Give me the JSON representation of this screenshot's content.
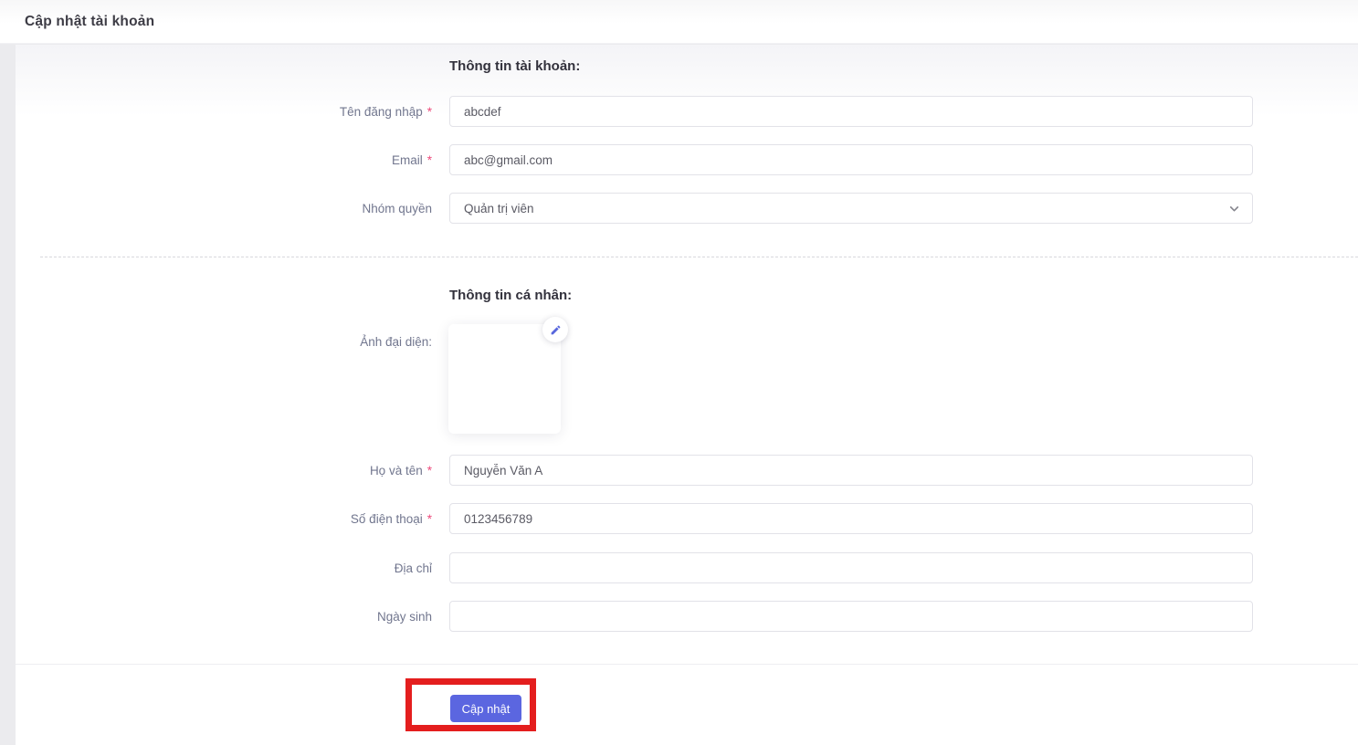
{
  "header": {
    "title": "Cập nhật tài khoản"
  },
  "account_section": {
    "title": "Thông tin tài khoản:",
    "fields": [
      {
        "label": "Tên đăng nhập",
        "required": "*",
        "value": "abcdef"
      },
      {
        "label": "Email",
        "required": "*",
        "value": "abc@gmail.com"
      },
      {
        "label": "Nhóm quyền",
        "required": "",
        "value": "Quản trị viên"
      }
    ]
  },
  "personal_section": {
    "title": "Thông tin cá nhân:",
    "avatar": {
      "label": "Ảnh đại diện:",
      "edit_icon": "pencil-icon"
    },
    "fields": [
      {
        "label": "Họ và tên",
        "required": "*",
        "value": "Nguyễn Văn A"
      },
      {
        "label": "Số điện thoại",
        "required": "*",
        "value": "0123456789"
      },
      {
        "label": "Địa chỉ",
        "required": "",
        "value": ""
      },
      {
        "label": "Ngày sinh",
        "required": "",
        "value": ""
      }
    ]
  },
  "footer": {
    "submit_label": "Cập nhật"
  },
  "icons": {
    "select_chevron": "chevron-down-icon",
    "avatar_edit": "pencil-icon"
  },
  "colors": {
    "primary_button": "#5b66e0",
    "annotation_red": "#e41e1e",
    "label_text": "#71768e",
    "required_asterisk": "#ed4a7b",
    "section_title": "#32313c",
    "pencil_icon": "#5867dd"
  }
}
